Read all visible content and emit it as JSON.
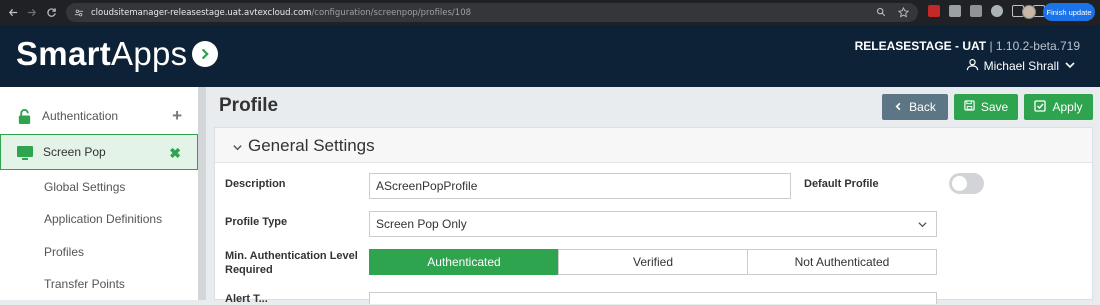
{
  "browser": {
    "url_host": "cloudsitemanager-releasestage.uat.avtexcloud.com",
    "url_path": "/configuration/screenpop/profiles/108",
    "finish_update": "Finish update"
  },
  "header": {
    "brand_bold": "Smart",
    "brand_light": "Apps",
    "environment": "RELEASESTAGE - UAT",
    "separator": " | ",
    "version": "1.10.2-beta.719",
    "user_name": "Michael Shrall"
  },
  "sidebar": {
    "items": [
      {
        "label": "Authentication",
        "action": "+"
      },
      {
        "label": "Screen Pop",
        "action": "✖"
      }
    ],
    "sub_items": [
      "Global Settings",
      "Application Definitions",
      "Profiles",
      "Transfer Points"
    ]
  },
  "page": {
    "title": "Profile",
    "back_label": "Back",
    "save_label": "Save",
    "apply_label": "Apply"
  },
  "general": {
    "title": "General Settings",
    "description_label": "Description",
    "description_value": "AScreenPopProfile",
    "default_profile_label": "Default Profile",
    "default_profile_on": false,
    "profile_type_label": "Profile Type",
    "profile_type_value": "Screen Pop Only",
    "min_auth_label_1": "Min. Authentication Level",
    "min_auth_label_2": "Required",
    "auth_options": [
      "Authenticated",
      "Verified",
      "Not Authenticated"
    ],
    "auth_selected": "Authenticated",
    "next_label_partial": "Alert T..."
  },
  "colors": {
    "header_bg": "#0d2137",
    "accent_green": "#2ea44f",
    "back_button": "#5d7685"
  }
}
